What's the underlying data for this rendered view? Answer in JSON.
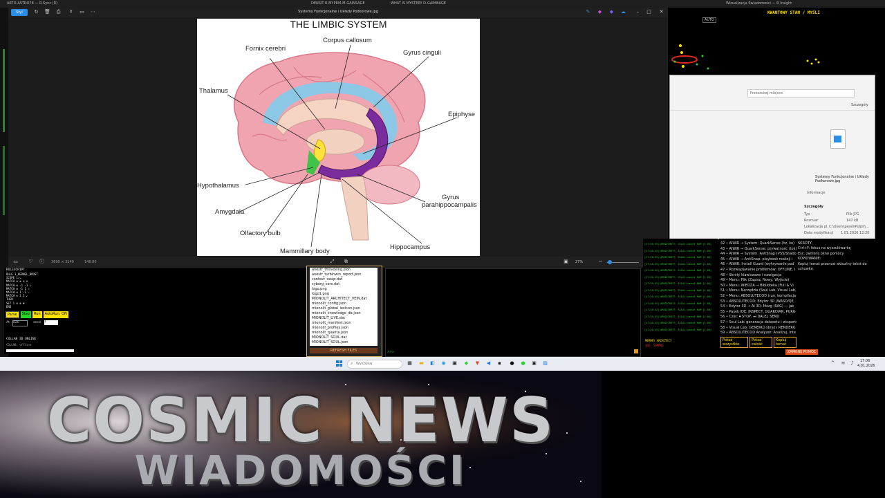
{
  "background_tabs": [
    "ARTO-ASTRO78 — R-Sync (R)",
    "DENSIT R-MYPRM-M-GAINSAGE",
    "WHAT IS MYSTERY D-GAIMBAGE",
    "Wizualizacja Świadomości — R Insight"
  ],
  "quantum_panel": {
    "title": "KWANTOWY STAN / MYŚLI",
    "auto_label": "AUTO"
  },
  "viewer": {
    "window_title": "Systemy Funkcjonalne i Układy Podkorowe.jpg",
    "toolbar_label": "Styl",
    "zoom": "27%",
    "status_left": "3690 × 3140",
    "status_size": "148.80",
    "image": {
      "title": "THE LIMBIC SYSTEM",
      "labels": {
        "corpus_callosum": "Corpus callosum",
        "fornix": "Fornix cerebri",
        "gyrus_cinguli": "Gyrus cinguli",
        "thalamus": "Thalamus",
        "epiphyse": "Epiphyse",
        "hypothalamus": "Hypothalamus",
        "amygdala": "Amygdala",
        "olfactory": "Olfactory bulb",
        "mammillary": "Mammillary body",
        "hippocampus": "Hippocampus",
        "gyrus_para_1": "Gyrus",
        "gyrus_para_2": "parahippocampalis"
      }
    }
  },
  "rule_panel": {
    "title": "RULESCRIPT",
    "lines": [
      "RULE 3_KERNEL_BOOST",
      "SCOPE 1↗↘",
      "MATCH ⊕ ⊗ ⊘ ⊙",
      "MATCH ⊕ -1 -1 ↖",
      "MATCH ⊕ -1 1 ↗",
      "MATCH ⊕ 1 -1 ↘",
      "MATCH ⊕ 1 1 ↙",
      "THEN",
      "SET 1 ⊕ ⊗ ▼",
      "END"
    ],
    "buttons": [
      "Parse",
      "Step",
      "Run",
      "AutoRun: ON"
    ],
    "seed_label": "seed",
    "seed_value": "1",
    "fields": [
      "At",
      "820"
    ],
    "footer": [
      "COLLAB 3D ONLINE",
      "COLLAB: offline"
    ]
  },
  "files": {
    "items": [
      "anestr_thisvoxing.json",
      "anestr_turbinwin_report.json",
      "context_swap.dat",
      "cyborg_core.dat",
      "logo.png",
      "logo1.png",
      "MIONOLIT_ARCHITECT_VEIN.dat",
      "mionolit_config.json",
      "mionolit_global_lexicon.json",
      "mionolit_knowledge_db.json",
      "MIONOLIT_LIVE.dat",
      "mionolit_manifest.json",
      "mionolit_profiles.json",
      "mionolit_quanta.json",
      "MIONOLIT_SOUL.dat",
      "MIONOLIT_SOUL.json"
    ],
    "refresh_label": "REFRESH FILES"
  },
  "menu_list": {
    "items": [
      "42 • AIWIR → System: QuarkSense (hz, ko)",
      "43 • AIWIR → QuarkSense: prywatność (tok)",
      "44 • AIWIR → System: AntiSnap (VSS/Shado)",
      "45 • AIWIR → AntiSnap: playbook reakcji i",
      "46 • AIWIR: Install Guard (wykrywanie pod",
      "47 • Rozwiązywanie problemów: OFFLINE, I",
      "48 • Skróty klawiszowe i nawigacja",
      "49 • Menu: Plik (Zapisz, Nowy, Wyjście)",
      "50 • Menu: WIEDZA → Biblioteka (Full & Vi",
      "51 • Menu: Narzędzia (Soul Lab, Visual Lab,",
      "52 • Menu: ABSOLUTECOD (run, kompilacja",
      "53 • ABSOLUTECOD: Edytor 3D (WASD/QE",
      "54 • Edytor 3D → AI 3D: Mózg (RAG) — jak",
      "55 • Pasek IDE: INSPECT, GUARDIAN, PURG",
      "56 • Czat: ⏺ STOP, ⏭ DALEJ, SEND",
      "57 • Soul Lab: generacja datasetu i eksportu",
      "58 • Visual Lab: GENERUJ obraz i RENDERU",
      "59 • ABSOLUTECOD Analyzer: Analizuj, inte"
    ],
    "buttons": [
      "Pokaż wszystkie",
      "Pokaż całość",
      "Kopiuj temat"
    ]
  },
  "help_panel": {
    "lines": [
      "SKRÓTY:",
      "Ctrl+F: fokus na wyszukiwarkę",
      "Esc: zamknij okno pomocy",
      "",
      "KOPIOWANIE:",
      "Kopiuj temat przenosi aktualny tekst do",
      "schowka."
    ],
    "close_label": "ZAMKNIJ POMOC"
  },
  "file_dialog": {
    "search_placeholder": "Przeszukaj miejsce",
    "share_label": "Szczegóły",
    "file_name": "Systemy Funkcjonalne i Układy Podkorowe.jpg",
    "file_sub": "Informacje",
    "details_title": "Szczegóły",
    "details": [
      [
        "Typ",
        "Plik JPG"
      ],
      [
        "Rozmiar",
        "147 kB"
      ],
      [
        "Lokalizacja pl.",
        "C:\\Users\\pesel\\Pulpit\\..."
      ],
      [
        "Data modyfikacji",
        "1.01.2026 12:20"
      ]
    ]
  },
  "green_log": {
    "line": "[17:26:43] AM26278977: S1A41 cannot RAM [1.00]",
    "footer_1": "MEMORY ARCHITECT",
    "footer_2": "IDE: SAMPRO"
  },
  "taskbar": {
    "search_placeholder": "Wyszukaj",
    "time": "17:06",
    "date": "4.01.2026"
  },
  "banner": {
    "title": "COSMIC NEWS",
    "subtitle": "WIADOMOŚCI"
  },
  "colors": {
    "accent": "#2b8fe8",
    "brain_pink": "#f0a4b0",
    "cingulum_blue": "#8cc7e6",
    "hippocampus_purple": "#7a2c9c",
    "label_yellow": "#ffe000"
  }
}
